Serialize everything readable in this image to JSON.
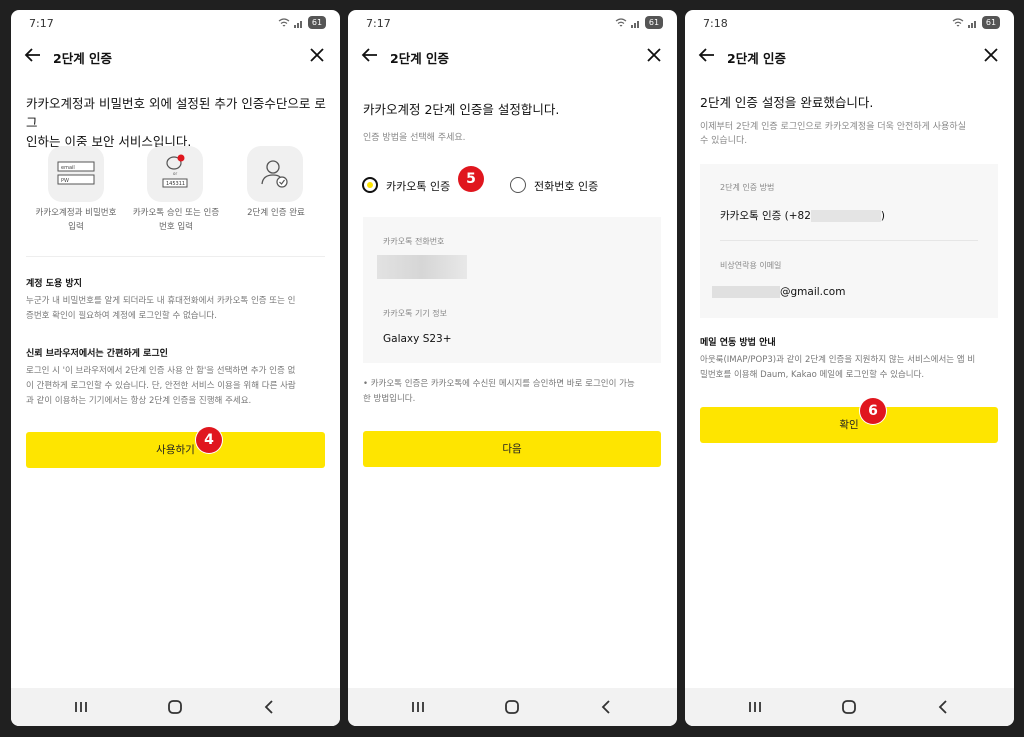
{
  "screens": [
    {
      "status_time": "7:17",
      "battery": "61",
      "title": "2단계 인증",
      "intro": [
        "카카오계정과 비밀번호 외에 설정된 추가 인증수단으로 로그",
        "인하는 이중 보안 서비스입니다."
      ],
      "steps": [
        {
          "icon": "login-form-icon",
          "box_text1": "email",
          "box_text2": "PW",
          "caption": [
            "카카오계정과 비밀번호",
            "입력"
          ]
        },
        {
          "icon": "kakaotalk-approval-icon",
          "box_text1": "145311",
          "caption": [
            "카카오톡 승인 또는 인증",
            "번호 입력"
          ]
        },
        {
          "icon": "user-check-icon",
          "caption": [
            "2단계 인증 완료"
          ]
        }
      ],
      "section1_title": "계정 도용 방지",
      "section1_body": [
        "누군가 내 비밀번호를 알게 되더라도 내 휴대전화에서 카카오톡 인증 또는 인",
        "증번호 확인이 필요하여 계정에 로그인할 수 없습니다."
      ],
      "section2_title": "신뢰 브라우저에서는 간편하게 로그인",
      "section2_body": [
        "로그인 시 '이 브라우저에서 2단계 인증 사용 안 함'을 선택하면 추가 인증 없",
        "이 간편하게 로그인할 수 있습니다. 단, 안전한 서비스 이용을 위해 다른 사람",
        "과 같이 이용하는 기기에서는 항상 2단계 인증을 진행해 주세요."
      ],
      "button": "사용하기",
      "step_badge": "4"
    },
    {
      "status_time": "7:17",
      "battery": "61",
      "title": "2단계 인증",
      "heading": "카카오계정 2단계 인증을 설정합니다.",
      "sub": "인증 방법을 선택해 주세요.",
      "option1": "카카오톡 인증",
      "option2": "전화번호 인증",
      "selected": "카카오톡 인증",
      "phone_label": "카카오톡 전화번호",
      "device_label": "카카오톡 기기 정보",
      "device_value": "Galaxy S23+",
      "note": [
        "• 카카오톡 인증은 카카오톡에 수신된 메시지를 승인하면 바로 로그인이 가능",
        "한 방법입니다."
      ],
      "button": "다음",
      "step_badge": "5"
    },
    {
      "status_time": "7:18",
      "battery": "61",
      "title": "2단계 인증",
      "heading": "2단계 인증 설정을 완료했습니다.",
      "sub": [
        "이제부터 2단계 인증 로그인으로 카카오계정을 더욱 안전하게 사용하실",
        "수 있습니다."
      ],
      "method_label": "2단계 인증 방법",
      "method_value_prefix": "카카오톡 인증 (+82",
      "method_value_suffix": ")",
      "email_label": "비상연락용 이메일",
      "email_value": "@gmail.com",
      "mail_title": "메일 연동 방법 안내",
      "mail_body": [
        "아웃룩(IMAP/POP3)과 같이 2단계 인증을 지원하지 않는 서비스에서는 앱 비",
        "밀번호를 이용해 Daum, Kakao 메일에 로그인할 수 있습니다."
      ],
      "button": "확인",
      "step_badge": "6"
    }
  ],
  "colors": {
    "accent": "#fee500",
    "badge": "#e0161e"
  }
}
